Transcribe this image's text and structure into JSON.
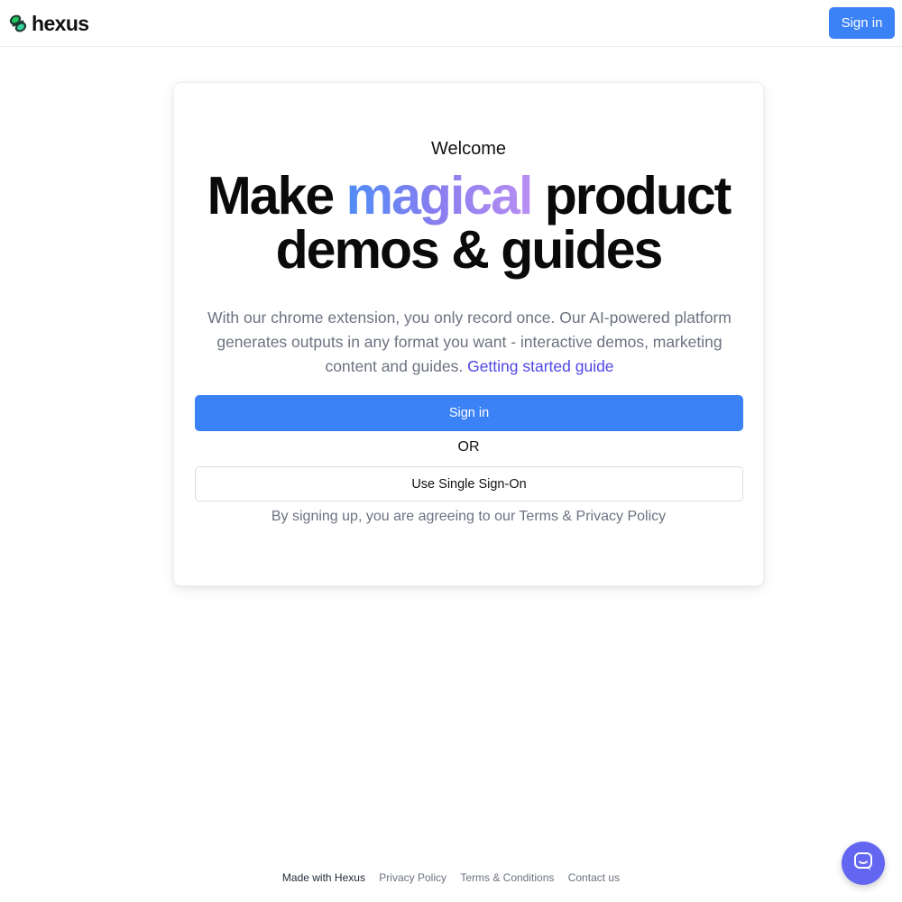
{
  "header": {
    "brand": "hexus",
    "logo_icon": "hexus-logo-icon",
    "signin_label": "Sign in"
  },
  "card": {
    "welcome": "Welcome",
    "headline_pre": "Make ",
    "headline_highlight": "magical",
    "headline_line1_post": " product",
    "headline_line2": "demos & guides",
    "description": "With our chrome extension, you only record once. Our AI-powered platform generates outputs in any format you want - interactive demos, marketing content and guides.",
    "guide_link": "Getting started guide",
    "signin_label": "Sign in",
    "or_label": "OR",
    "sso_label": "Use Single Sign-On",
    "terms": "By signing up, you are agreeing to our Terms & Privacy Policy"
  },
  "footer": {
    "made_with": "Made with Hexus",
    "privacy": "Privacy Policy",
    "terms": "Terms & Conditions",
    "contact": "Contact us"
  },
  "chat": {
    "icon": "chat-bubble-icon"
  },
  "colors": {
    "primary": "#3b82f6",
    "link": "#4f46e5",
    "highlight_start": "#4f8df6",
    "highlight_end": "#b98ff2",
    "chat": "#6366f1",
    "logo_green": "#22c55e",
    "logo_dark": "#1e3a34"
  }
}
